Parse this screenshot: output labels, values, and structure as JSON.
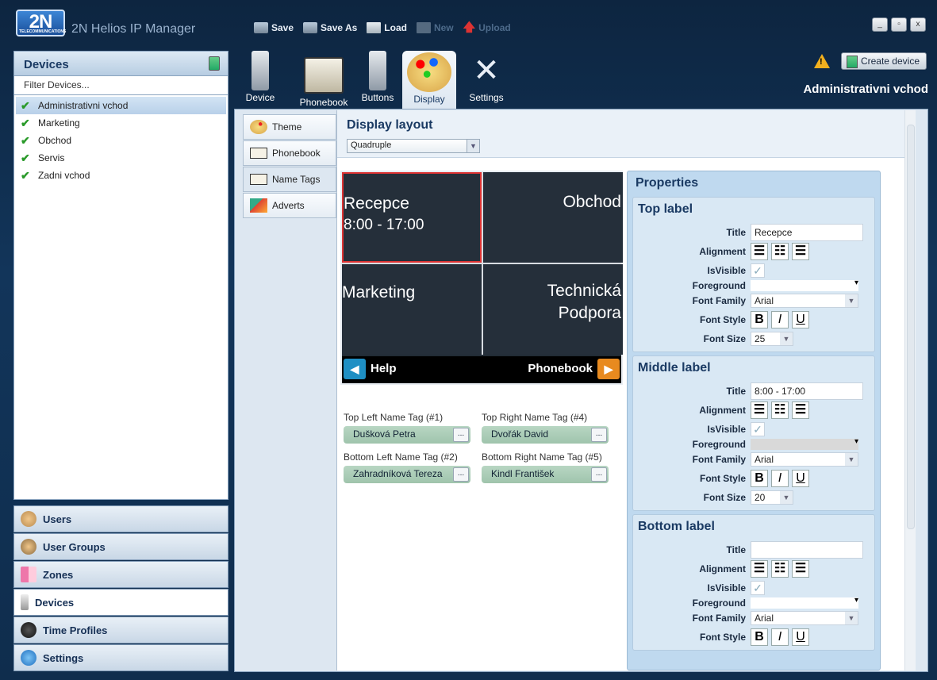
{
  "app": {
    "logo_text": "2N",
    "logo_sub": "TELECOMMUNICATIONS",
    "title": "2N Helios IP Manager"
  },
  "toolbar": {
    "save": "Save",
    "save_as": "Save As",
    "load": "Load",
    "new": "New",
    "upload": "Upload"
  },
  "window_buttons": {
    "minimize": "_",
    "maximize": "▫",
    "close": "x"
  },
  "devices_panel": {
    "header": "Devices",
    "filter_placeholder": "Filter Devices...",
    "items": [
      {
        "label": "Administrativni vchod",
        "selected": true
      },
      {
        "label": "Marketing",
        "selected": false
      },
      {
        "label": "Obchod",
        "selected": false
      },
      {
        "label": "Servis",
        "selected": false
      },
      {
        "label": "Zadni vchod",
        "selected": false
      }
    ]
  },
  "nav": {
    "users": "Users",
    "user_groups": "User Groups",
    "zones": "Zones",
    "devices": "Devices",
    "time_profiles": "Time Profiles",
    "settings": "Settings"
  },
  "main_tabs": {
    "device": "Device",
    "phonebook": "Phonebook",
    "buttons": "Buttons",
    "display": "Display",
    "settings": "Settings"
  },
  "header_right": {
    "create_device": "Create device",
    "device_name": "Administrativni vchod"
  },
  "sub_tabs": {
    "theme": "Theme",
    "phonebook": "Phonebook",
    "name_tags": "Name Tags",
    "adverts": "Adverts"
  },
  "display_layout": {
    "title": "Display layout",
    "selected": "Quadruple"
  },
  "preview": {
    "cell1_top": "Recepce",
    "cell1_mid": "8:00 - 17:00",
    "cell2_top": "Obchod",
    "cell3_top": "Marketing",
    "cell4_line1": "Technická",
    "cell4_line2": "Podpora",
    "help": "Help",
    "phonebook": "Phonebook"
  },
  "name_tags": {
    "tl_label": "Top Left Name Tag (#1)",
    "tl_value": "Dušková Petra",
    "tr_label": "Top Right Name Tag (#4)",
    "tr_value": "Dvořák David",
    "bl_label": "Bottom Left Name Tag (#2)",
    "bl_value": "Zahradníková Tereza",
    "br_label": "Bottom Right Name Tag (#5)",
    "br_value": "Kindl František",
    "more": "..."
  },
  "properties": {
    "title": "Properties",
    "labels": {
      "title": "Title",
      "alignment": "Alignment",
      "isvisible": "IsVisible",
      "foreground": "Foreground",
      "font_family": "Font Family",
      "font_style": "Font Style",
      "font_size": "Font Size"
    },
    "style_buttons": {
      "bold": "B",
      "italic": "I",
      "underline": "U"
    },
    "top": {
      "heading": "Top label",
      "title": "Recepce",
      "font_family": "Arial",
      "font_size": "25"
    },
    "middle": {
      "heading": "Middle label",
      "title": "8:00 - 17:00",
      "font_family": "Arial",
      "font_size": "20"
    },
    "bottom": {
      "heading": "Bottom label",
      "title": "",
      "font_family": "Arial"
    }
  }
}
